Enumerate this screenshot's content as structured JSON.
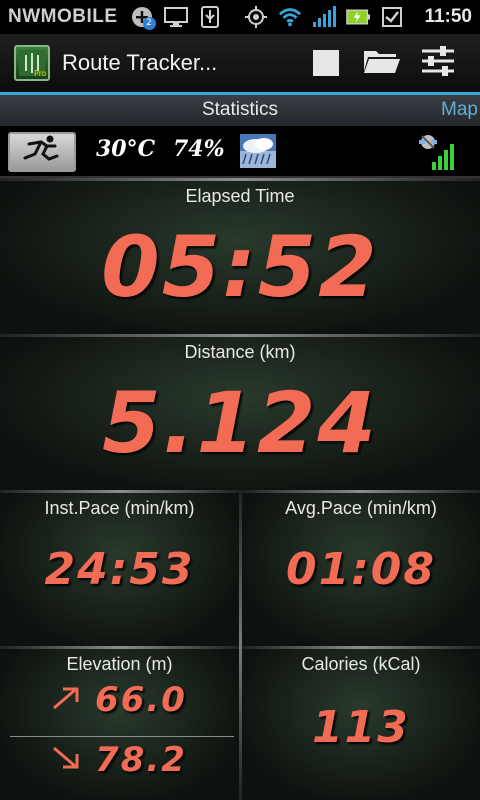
{
  "status_bar": {
    "carrier": "NWMOBILE",
    "notification_badge": "2",
    "time": "11:50",
    "icons": [
      "add-notification-icon",
      "monitor-icon",
      "usb-icon",
      "gps-target-icon",
      "wifi-icon",
      "signal-icon",
      "battery-charging-icon",
      "checkbox-icon"
    ]
  },
  "action_bar": {
    "title": "Route Tracker...",
    "icons": [
      "stop-icon",
      "folder-icon",
      "settings-sliders-icon"
    ]
  },
  "tabs": {
    "active": "Statistics",
    "next": "Map"
  },
  "toolbar": {
    "temperature": "30°C",
    "humidity": "74%",
    "icons": [
      "running-mode-icon",
      "weather-storm-icon",
      "gps-signal-icon"
    ]
  },
  "stats": {
    "elapsed_time": {
      "label": "Elapsed Time",
      "value": "05:52"
    },
    "distance": {
      "label": "Distance (km)",
      "value": "5.124"
    },
    "inst_pace": {
      "label": "Inst.Pace (min/km)",
      "value": "24:53"
    },
    "avg_pace": {
      "label": "Avg.Pace (min/km)",
      "value": "01:08"
    },
    "elevation": {
      "label": "Elevation (m)",
      "up": "66.0",
      "down": "78.2"
    },
    "calories": {
      "label": "Calories (kCal)",
      "value": "113"
    }
  },
  "colors": {
    "value": "#f26b55",
    "tab_accent": "#3aa3d8",
    "arrow": "#f26b55"
  }
}
